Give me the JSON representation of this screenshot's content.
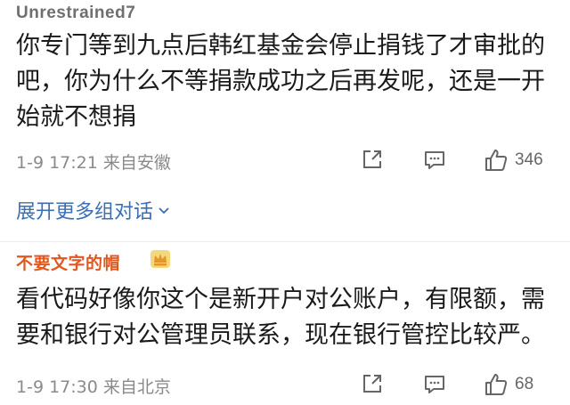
{
  "comments": [
    {
      "username": "Unrestrained7",
      "content": "你专门等到九点后韩红基金会停止捐钱了才审批的吧，你为什么不等捐款成功之后再发呢，还是一开始就不想捐",
      "timestamp": "1-9 17:21",
      "location": "来自安徽",
      "like_count": "346",
      "expand_label": "展开更多组对话"
    },
    {
      "username": "不要文字的帽",
      "content": "看代码好像你这个是新开户对公账户，有限额，需要和银行对公管理员联系，现在银行管控比较严。",
      "timestamp": "1-9 17:30",
      "location": "来自北京",
      "like_count": "68"
    }
  ],
  "icons": {
    "share": "share-icon",
    "reply": "comment-icon",
    "like": "thumbs-up-icon",
    "expand": "chevron-down-icon",
    "badge": "crown-icon"
  },
  "colors": {
    "link": "#3a6fb5",
    "meta": "#8a8a8a",
    "username2": "#e0571f"
  }
}
